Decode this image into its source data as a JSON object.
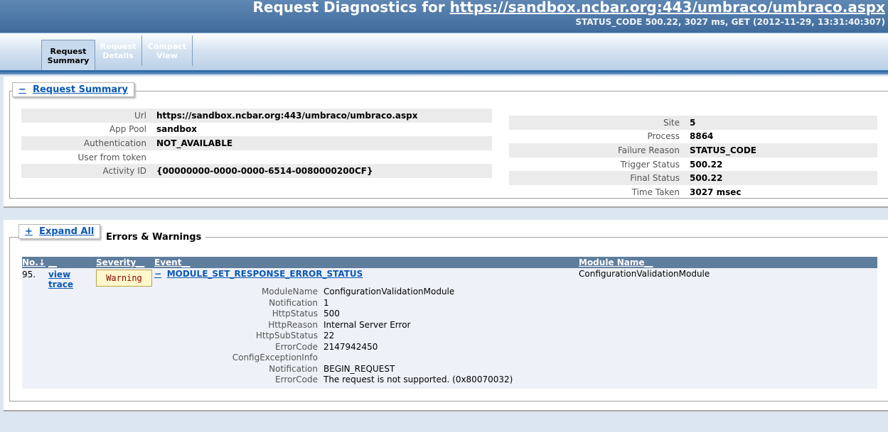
{
  "header": {
    "title_prefix": "Request Diagnostics for",
    "title_url": "https://sandbox.ncbar.org:443/umbraco/umbraco.aspx",
    "status_line": "STATUS_CODE 500.22, 3027 ms, GET (2012-11-29, 13:31:40:307)"
  },
  "tabs": [
    {
      "line1": "Request",
      "line2": "Summary",
      "active": true
    },
    {
      "line1": "Request",
      "line2": "Details",
      "active": false
    },
    {
      "line1": "Compact",
      "line2": "View",
      "active": false
    }
  ],
  "summary": {
    "toggle": "−",
    "legend": "Request Summary",
    "left": [
      {
        "key": "Url",
        "value": "https://sandbox.ncbar.org:443/umbraco/umbraco.aspx"
      },
      {
        "key": "App Pool",
        "value": "sandbox"
      },
      {
        "key": "Authentication",
        "value": "NOT_AVAILABLE"
      },
      {
        "key": "User from token",
        "value": ""
      },
      {
        "key": "Activity ID",
        "value": "{00000000-0000-0000-6514-0080000200CF}"
      }
    ],
    "right": [
      {
        "key": "Site",
        "value": "5"
      },
      {
        "key": "Process",
        "value": "8864"
      },
      {
        "key": "Failure Reason",
        "value": "STATUS_CODE"
      },
      {
        "key": "Trigger Status",
        "value": "500.22"
      },
      {
        "key": "Final Status",
        "value": "500.22"
      },
      {
        "key": "Time Taken",
        "value": "3027 msec"
      }
    ]
  },
  "errors": {
    "toggle": "+",
    "expand_label": "Expand All",
    "section_title": "Errors & Warnings",
    "columns": {
      "no": "No.↓",
      "blank": "__",
      "severity": "Severity__",
      "event": "Event__",
      "module": "Module Name__"
    },
    "row": {
      "no": "95.",
      "view": "view",
      "trace": "trace",
      "severity": "Warning",
      "event_toggle": "−",
      "event": "MODULE_SET_RESPONSE_ERROR_STATUS",
      "module": "ConfigurationValidationModule",
      "details": [
        {
          "key": "ModuleName",
          "value": "ConfigurationValidationModule"
        },
        {
          "key": "Notification",
          "value": "1"
        },
        {
          "key": "HttpStatus",
          "value": "500"
        },
        {
          "key": "HttpReason",
          "value": "Internal Server Error"
        },
        {
          "key": "HttpSubStatus",
          "value": "22"
        },
        {
          "key": "ErrorCode",
          "value": "2147942450"
        },
        {
          "key": "ConfigExceptionInfo",
          "value": ""
        },
        {
          "key": "Notification",
          "value": "BEGIN_REQUEST"
        },
        {
          "key": "ErrorCode",
          "value": "The request is not supported. (0x80070032)"
        }
      ]
    }
  }
}
